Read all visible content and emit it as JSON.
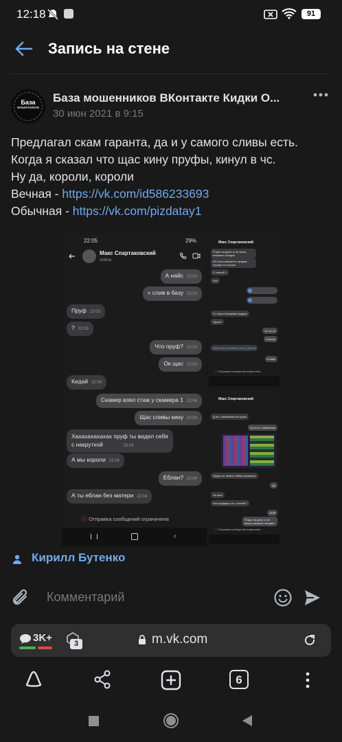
{
  "status_bar": {
    "time": "12:18",
    "battery": "91"
  },
  "header": {
    "title": "Запись на стене"
  },
  "post": {
    "group_name": "База мошенников ВКонтакте Кидки О...",
    "avatar_text_1": "База",
    "avatar_text_2": "мошенников",
    "date": "30 июн 2021 в 9:15",
    "lines": [
      "Предлагал скам гаранта, да и у самого сливы есть.",
      "Когда я сказал что щас кину пруфы, кинул в чс.",
      "Ну да, короли, короли"
    ],
    "link1_label": "Вечная - ",
    "link1_url": "https://vk.com/id586233693",
    "link2_label": "Обычная - ",
    "link2_url": "https://vk.com/pizdatay1",
    "author": "Кирилл Бутенко"
  },
  "screenshot_left": {
    "time": "22:05",
    "battery": "29%",
    "contact_name": "Макс Спартаковский",
    "contact_status": "online",
    "messages": [
      {
        "dir": "out",
        "text": "А найс",
        "time": "22:03"
      },
      {
        "dir": "out",
        "text": "+ слив в базу",
        "time": "22:03"
      },
      {
        "dir": "in",
        "text": "Пруф",
        "time": "22:03"
      },
      {
        "dir": "in",
        "text": "?",
        "time": "22:03"
      },
      {
        "dir": "out",
        "text": "Что пруф?",
        "time": "22:03"
      },
      {
        "dir": "out",
        "text": "Ок щас",
        "time": "22:03"
      },
      {
        "dir": "in",
        "text": "Кидай",
        "time": "22:04"
      },
      {
        "dir": "out",
        "text": "Скамер взял стаж у скамера 1",
        "time": "22:04"
      },
      {
        "dir": "out",
        "text": "Щас сливы кину",
        "time": "22:04"
      },
      {
        "dir": "in",
        "text": "Хахахахахахах пруф ты видел себя",
        "time": ""
      },
      {
        "dir": "in",
        "text": "с накруткой",
        "time": "22:04"
      },
      {
        "dir": "in",
        "text": "А мы короли",
        "time": "22:04"
      },
      {
        "dir": "out",
        "text": "Еблан?",
        "time": "22:04"
      },
      {
        "dir": "in",
        "text": "А ты еблан без матери",
        "time": "22:04"
      }
    ],
    "restricted": "Отправка сообщений ограничена"
  },
  "screenshot_right_top": {
    "contact_name": "Макс Спартаковский",
    "messages": [
      "Я щас на даче, я не смогу показать сегодня",
      "Мб если завтра не продам , покажу по ссылке",
      "С топчей ?",
      "Ано",
      "Го через Лисикова продаш",
      "Гарант",
      "Чо за он",
      "Ссылку",
      "https://vk.com/nikita_lesnoi_tigrenq",
      "А найс"
    ],
    "restricted": "Отправка сообщений ограничена"
  },
  "screenshot_right_bottom": {
    "contact_name": "Макс Спартаковский",
    "messages": [
      "Д не с айсменом бы купил",
      "Ну есть с айсменом",
      "Пруф что твой в лобби покажешь",
      "Да",
      "За скок",
      "Ано продашь он с топчей ?",
      "400₽",
      "Я щас на даче, я не смогу показать сегодня"
    ],
    "restricted": "Отправка сообщений ограничена"
  },
  "comment": {
    "placeholder": "Комментарий"
  },
  "browser": {
    "comments_count": "3K+",
    "tab_badge": "3",
    "url": "m.vk.com",
    "tabs_count": "6"
  },
  "colors": {
    "background": "#19191a",
    "link": "#71aaeb",
    "secondary_text": "#76787a"
  }
}
